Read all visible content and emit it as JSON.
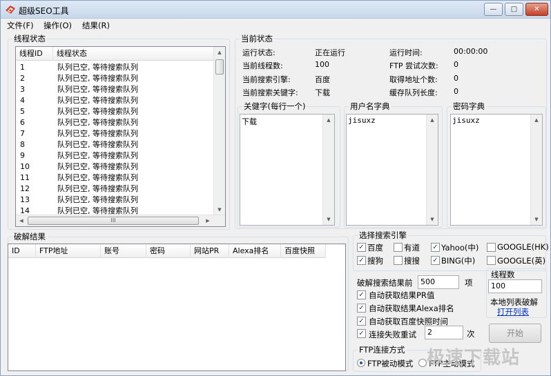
{
  "window": {
    "title": "超级SEO工具",
    "min_glyph": "—",
    "max_glyph": "□",
    "close_glyph": "✕"
  },
  "menu": [
    "文件(F)",
    "操作(O)",
    "结果(R)"
  ],
  "thread_status": {
    "group_title": "线程状态",
    "headers": [
      "线程ID",
      "线程状态"
    ],
    "rows": [
      {
        "id": "1",
        "status": "队列已空, 等待搜索队列"
      },
      {
        "id": "2",
        "status": "队列已空, 等待搜索队列"
      },
      {
        "id": "3",
        "status": "队列已空, 等待搜索队列"
      },
      {
        "id": "4",
        "status": "队列已空, 等待搜索队列"
      },
      {
        "id": "5",
        "status": "队列已空, 等待搜索队列"
      },
      {
        "id": "6",
        "status": "队列已空, 等待搜索队列"
      },
      {
        "id": "7",
        "status": "队列已空, 等待搜索队列"
      },
      {
        "id": "8",
        "status": "队列已空, 等待搜索队列"
      },
      {
        "id": "9",
        "status": "队列已空, 等待搜索队列"
      },
      {
        "id": "10",
        "status": "队列已空, 等待搜索队列"
      },
      {
        "id": "11",
        "status": "队列已空, 等待搜索队列"
      },
      {
        "id": "12",
        "status": "队列已空, 等待搜索队列"
      },
      {
        "id": "13",
        "status": "队列已空, 等待搜索队列"
      },
      {
        "id": "14",
        "status": "队列已空, 等待搜索队列"
      }
    ],
    "hscroll_grip": "III"
  },
  "current_status": {
    "group_title": "当前状态",
    "left": [
      {
        "label": "运行状态:",
        "value": "正在运行"
      },
      {
        "label": "当前线程数:",
        "value": "100"
      },
      {
        "label": "当前搜索引擎:",
        "value": "百度"
      },
      {
        "label": "当前搜索关键字:",
        "value": "下载"
      }
    ],
    "right": [
      {
        "label": "运行时间:",
        "value": "00:00:00"
      },
      {
        "label": "FTP 尝试次数:",
        "value": "0"
      },
      {
        "label": "取得地址个数:",
        "value": "0"
      },
      {
        "label": "缓存队列长度:",
        "value": "0"
      }
    ]
  },
  "keywords": {
    "title": "关健字(每行一个)",
    "value": "下载"
  },
  "usernames": {
    "title": "用户名字典",
    "value": "jisuxz"
  },
  "passwords": {
    "title": "密码字典",
    "value": "jisuxz"
  },
  "results": {
    "group_title": "破解结果",
    "headers": [
      "ID",
      "FTP地址",
      "账号",
      "密码",
      "网站PR",
      "Alexa排名",
      "百度快照"
    ]
  },
  "engines": {
    "group_title": "选择搜索引擎",
    "items": [
      {
        "label": "百度",
        "checked": true
      },
      {
        "label": "有道",
        "checked": false
      },
      {
        "label": "Yahoo(中)",
        "checked": true
      },
      {
        "label": "GOOGLE(HK)",
        "checked": false
      },
      {
        "label": "搜狗",
        "checked": true
      },
      {
        "label": "搜搜",
        "checked": false
      },
      {
        "label": "BING(中)",
        "checked": true
      },
      {
        "label": "GOOGLE(英)",
        "checked": false
      }
    ]
  },
  "options": {
    "results_label": "破解搜索结果前",
    "results_value": "500",
    "results_unit": "项",
    "checks": [
      {
        "label": "自动获取结果PR值",
        "checked": true
      },
      {
        "label": "自动获取结果Alexa排名",
        "checked": true
      },
      {
        "label": "自动获取百度快照时间",
        "checked": true
      }
    ],
    "retry_label": "连接失败重试",
    "retry_checked": true,
    "retry_value": "2",
    "retry_unit": "次"
  },
  "threads": {
    "label": "线程数",
    "value": "100"
  },
  "local_list": {
    "label": "本地列表破解",
    "link": "打开列表"
  },
  "start_button": "开始",
  "ftp_mode": {
    "group_title": "FTP连接方式",
    "passive": "FTP被动模式",
    "active": "FTP主动模式"
  },
  "watermark": "极速下载站",
  "check_glyph": "✓",
  "arrows": {
    "up": "▲",
    "down": "▼",
    "left": "◀",
    "right": "▶"
  },
  "colors": {
    "link": "#0033cc",
    "close": "#c4422a"
  }
}
